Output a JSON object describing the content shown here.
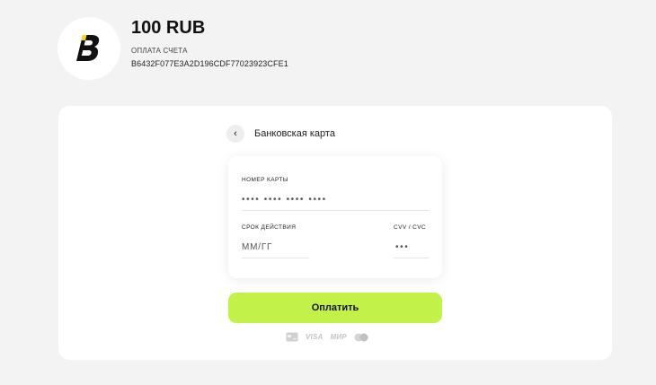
{
  "header": {
    "amount": "100 RUB",
    "invoice_label": "ОПЛАТА СЧЕТА",
    "invoice_id": "B6432F077E3A2D196CDF77023923CFE1"
  },
  "method": {
    "back_icon": "chevron-left-icon",
    "title": "Банковская карта"
  },
  "card_form": {
    "number_label": "НОМЕР КАРТЫ",
    "number_placeholder": "•••• •••• •••• ••••",
    "expiry_label": "СРОК ДЕЙСТВИЯ",
    "expiry_placeholder": "ММ/ГГ",
    "cvv_label": "CVV / CVC",
    "cvv_placeholder": "•••"
  },
  "pay_button": {
    "label": "Оплатить",
    "color": "#c2f24a"
  },
  "payment_brands": {
    "card_icon": "bank-card-icon",
    "visa": "VISA",
    "mir": "МИР",
    "mastercard_icon": "mastercard-icon"
  }
}
